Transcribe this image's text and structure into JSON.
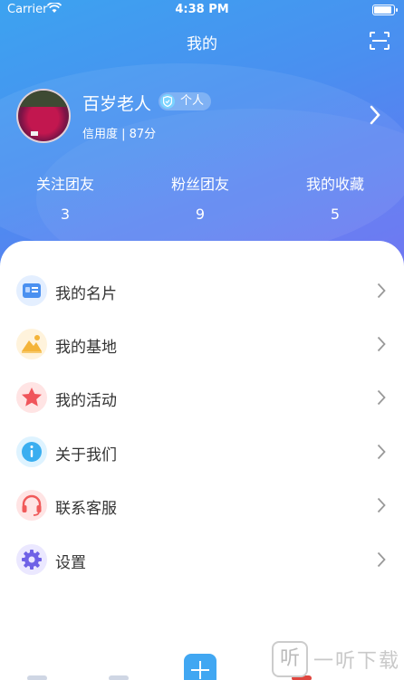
{
  "status_bar": {
    "carrier": "Carrier",
    "time": "4:38 PM"
  },
  "header": {
    "title": "我的"
  },
  "profile": {
    "name": "百岁老人",
    "badge": "个人",
    "credit": "信用度 | 87分"
  },
  "stats": [
    {
      "label": "关注团友",
      "value": "3"
    },
    {
      "label": "粉丝团友",
      "value": "9"
    },
    {
      "label": "我的收藏",
      "value": "5"
    }
  ],
  "menu": [
    {
      "label": "我的名片",
      "icon": "card-icon",
      "color": "#4a90f0"
    },
    {
      "label": "我的基地",
      "icon": "mountain-icon",
      "color": "#f4b43a"
    },
    {
      "label": "我的活动",
      "icon": "star-icon",
      "color": "#f0555b"
    },
    {
      "label": "关于我们",
      "icon": "info-icon",
      "color": "#3aaef0"
    },
    {
      "label": "联系客服",
      "icon": "headset-icon",
      "color": "#f05a5a"
    },
    {
      "label": "设置",
      "icon": "gear-icon",
      "color": "#6f62e6"
    }
  ],
  "watermark": {
    "logo": "听",
    "text": "一听下载"
  },
  "colors": {
    "accent": "#41a7f2",
    "hero_start": "#3ca3f0",
    "hero_end": "#6a6ff2"
  }
}
